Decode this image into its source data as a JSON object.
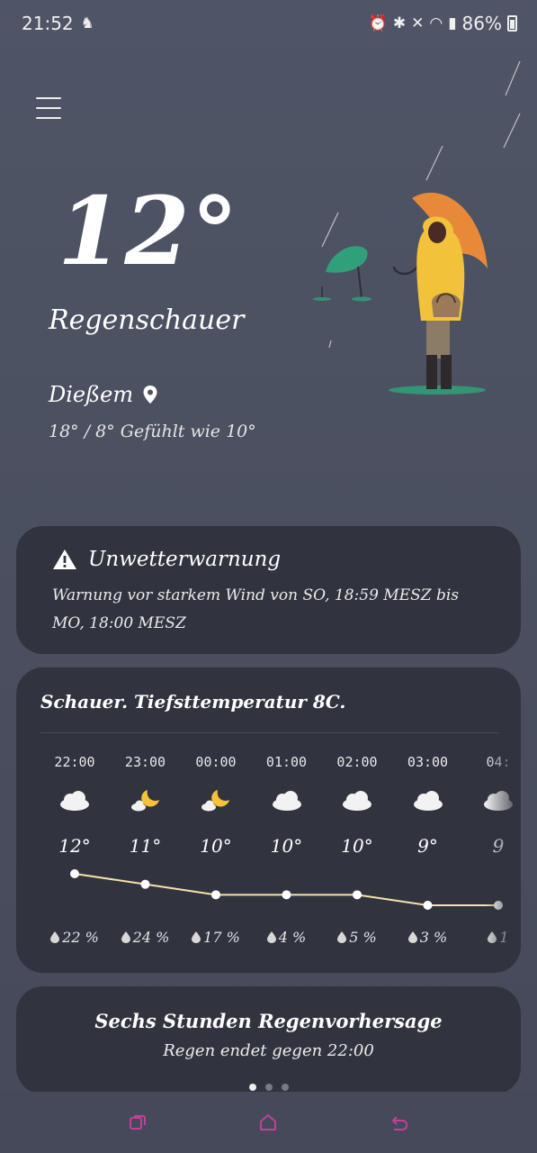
{
  "status_bar": {
    "time": "21:52",
    "battery": "86%",
    "icons": [
      "notification-icon",
      "alarm-icon",
      "bluetooth-icon",
      "mute-icon",
      "wifi-icon",
      "signal-icon",
      "battery-icon"
    ]
  },
  "current": {
    "temperature": "12°",
    "condition": "Regenschauer",
    "location": "Dießem",
    "minmax_feels": "18° / 8° Gefühlt wie 10°"
  },
  "warning": {
    "title": "Unwetterwarnung",
    "text": "Warnung vor starkem Wind von SO, 18:59 MESZ bis MO, 18:00 MESZ"
  },
  "forecast": {
    "summary": "Schauer. Tiefsttemperatur 8C.",
    "hours": [
      {
        "time": "22:00",
        "icon": "cloud-icon",
        "temp": "12°",
        "rain": "22 %",
        "value": 12
      },
      {
        "time": "23:00",
        "icon": "moon-cloud-icon",
        "temp": "11°",
        "rain": "24 %",
        "value": 11
      },
      {
        "time": "00:00",
        "icon": "moon-cloud-icon",
        "temp": "10°",
        "rain": "17 %",
        "value": 10
      },
      {
        "time": "01:00",
        "icon": "cloud-icon",
        "temp": "10°",
        "rain": "4 %",
        "value": 10
      },
      {
        "time": "02:00",
        "icon": "cloud-icon",
        "temp": "10°",
        "rain": "5 %",
        "value": 10
      },
      {
        "time": "03:00",
        "icon": "cloud-icon",
        "temp": "9°",
        "rain": "3 %",
        "value": 9
      },
      {
        "time": "04:",
        "icon": "cloud-icon",
        "temp": "9",
        "rain": "1",
        "value": 9
      }
    ]
  },
  "rain_forecast": {
    "title": "Sechs Stunden Regenvorhersage",
    "subtitle": "Regen endet gegen 22:00",
    "pages": 3,
    "active_page": 0
  },
  "colors": {
    "card": "#31343f",
    "accent_umbrella": "#e8893a",
    "raincoat": "#f2c23a",
    "leaf": "#2fa07a",
    "trend_line": "#f5e2a8",
    "nav_icon": "#c0409a"
  }
}
